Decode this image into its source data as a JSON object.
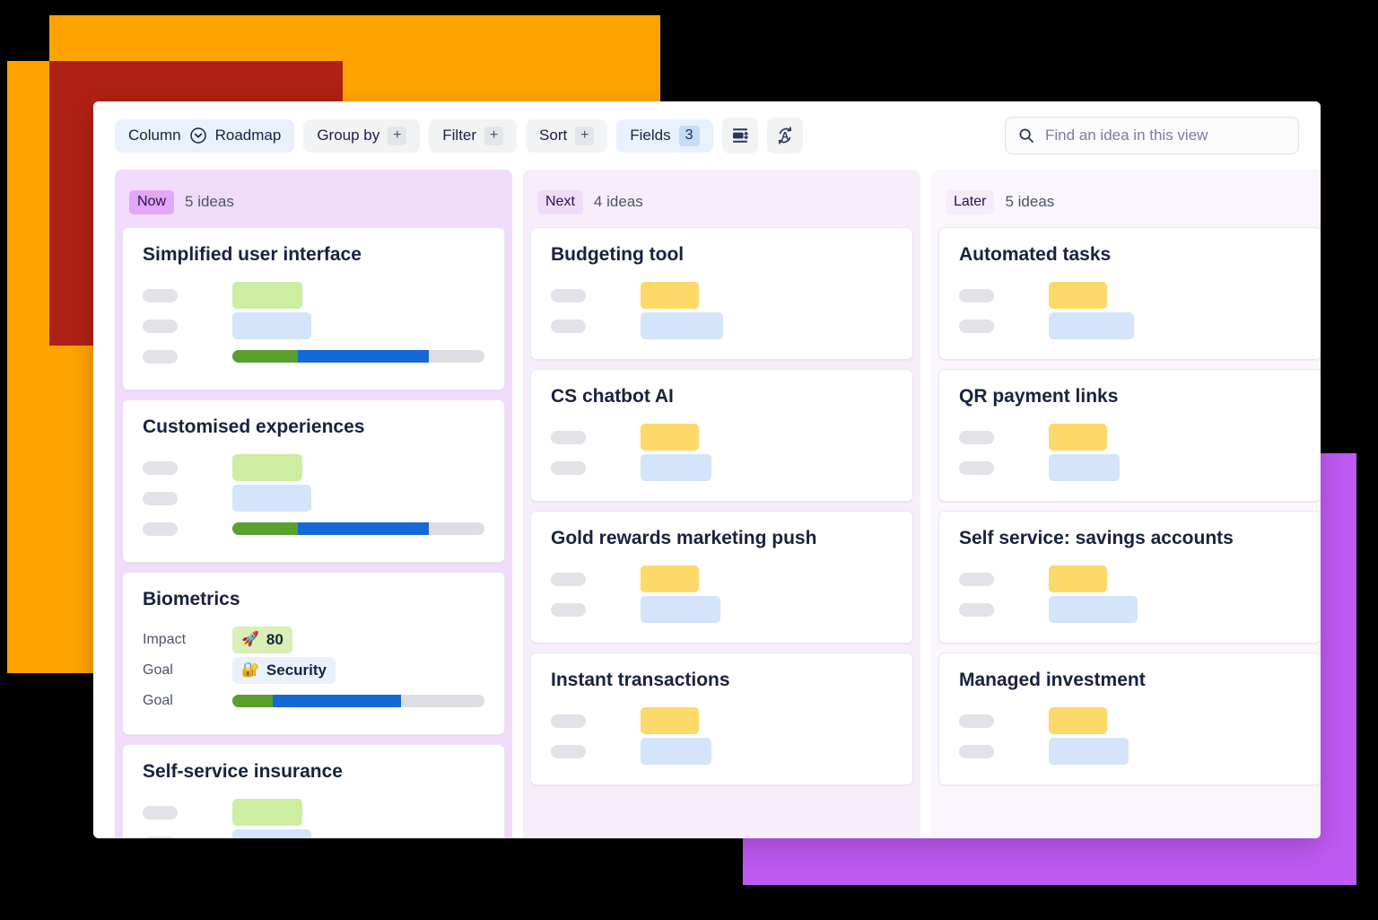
{
  "toolbar": {
    "column_label": "Column",
    "column_value": "Roadmap",
    "column_icon": "chevron-down-circle-icon",
    "group_by_label": "Group by",
    "group_by_plus": "+",
    "filter_label": "Filter",
    "filter_plus": "+",
    "sort_label": "Sort",
    "sort_plus": "+",
    "fields_label": "Fields",
    "fields_count": "3",
    "row_height_icon": "row-height-icon",
    "translate_icon": "auto-translate-icon",
    "search_icon": "search-icon",
    "search_placeholder": "Find an idea in this view",
    "search_value": ""
  },
  "colors": {
    "accent_purple": "#BF5AF2",
    "accent_orange": "#FFA300",
    "accent_red": "#B02014",
    "now_column_bg": "#f0dcfa",
    "next_column_bg": "#f8eefb",
    "later_column_bg": "#fbf5fd",
    "value_green": "#cdeda2",
    "value_blue": "#d3e4fb",
    "value_yellow": "#fcd968",
    "progress_green": "#5aa02c",
    "progress_blue": "#1569d6",
    "progress_track": "#dcdee3"
  },
  "board": {
    "columns": [
      {
        "name": "Now",
        "count_label": "5 ideas",
        "cards": [
          {
            "title": "Simplified user interface",
            "rows": [
              {
                "kind": "skeleton",
                "value_style": "green",
                "value_width": 78
              },
              {
                "kind": "skeleton",
                "value_style": "blue",
                "value_width": 88
              },
              {
                "kind": "progress",
                "green_pct": 26,
                "blue_pct": 52
              }
            ]
          },
          {
            "title": "Customised experiences",
            "rows": [
              {
                "kind": "skeleton",
                "value_style": "green",
                "value_width": 78
              },
              {
                "kind": "skeleton",
                "value_style": "blue",
                "value_width": 88
              },
              {
                "kind": "progress",
                "green_pct": 26,
                "blue_pct": 52
              }
            ]
          },
          {
            "title": "Biometrics",
            "rows": [
              {
                "kind": "chip",
                "label": "Impact",
                "emoji": "🚀",
                "emoji_name": "rocket-icon",
                "text": "80",
                "chip_style": "green"
              },
              {
                "kind": "chip",
                "label": "Goal",
                "emoji": "🔐",
                "emoji_name": "locked-with-key-icon",
                "text": "Security",
                "chip_style": "blue"
              },
              {
                "kind": "progress",
                "label": "Goal",
                "green_pct": 16,
                "blue_pct": 51
              }
            ]
          },
          {
            "title": "Self-service insurance",
            "rows": [
              {
                "kind": "skeleton",
                "value_style": "green",
                "value_width": 78
              },
              {
                "kind": "skeleton",
                "value_style": "blue",
                "value_width": 88
              }
            ]
          }
        ]
      },
      {
        "name": "Next",
        "count_label": "4 ideas",
        "cards": [
          {
            "title": "Budgeting tool",
            "rows": [
              {
                "kind": "skeleton",
                "value_style": "yellow",
                "value_width": 65
              },
              {
                "kind": "skeleton",
                "value_style": "blue",
                "value_width": 92
              }
            ]
          },
          {
            "title": "CS chatbot AI",
            "rows": [
              {
                "kind": "skeleton",
                "value_style": "yellow",
                "value_width": 65
              },
              {
                "kind": "skeleton",
                "value_style": "blue",
                "value_width": 79
              }
            ]
          },
          {
            "title": "Gold rewards marketing push",
            "rows": [
              {
                "kind": "skeleton",
                "value_style": "yellow",
                "value_width": 65
              },
              {
                "kind": "skeleton",
                "value_style": "blue",
                "value_width": 89
              }
            ]
          },
          {
            "title": "Instant transactions",
            "rows": [
              {
                "kind": "skeleton",
                "value_style": "yellow",
                "value_width": 65
              },
              {
                "kind": "skeleton",
                "value_style": "blue",
                "value_width": 79
              }
            ]
          }
        ]
      },
      {
        "name": "Later",
        "count_label": "5 ideas",
        "cards": [
          {
            "title": "Automated tasks",
            "rows": [
              {
                "kind": "skeleton",
                "value_style": "yellow",
                "value_width": 65
              },
              {
                "kind": "skeleton",
                "value_style": "blue",
                "value_width": 95
              }
            ]
          },
          {
            "title": "QR payment links",
            "rows": [
              {
                "kind": "skeleton",
                "value_style": "yellow",
                "value_width": 65
              },
              {
                "kind": "skeleton",
                "value_style": "blue",
                "value_width": 79
              }
            ]
          },
          {
            "title": "Self service: savings accounts",
            "rows": [
              {
                "kind": "skeleton",
                "value_style": "yellow",
                "value_width": 65
              },
              {
                "kind": "skeleton",
                "value_style": "blue",
                "value_width": 99
              }
            ]
          },
          {
            "title": "Managed investment",
            "rows": [
              {
                "kind": "skeleton",
                "value_style": "yellow",
                "value_width": 65
              },
              {
                "kind": "skeleton",
                "value_style": "blue",
                "value_width": 89
              }
            ]
          }
        ]
      }
    ]
  }
}
